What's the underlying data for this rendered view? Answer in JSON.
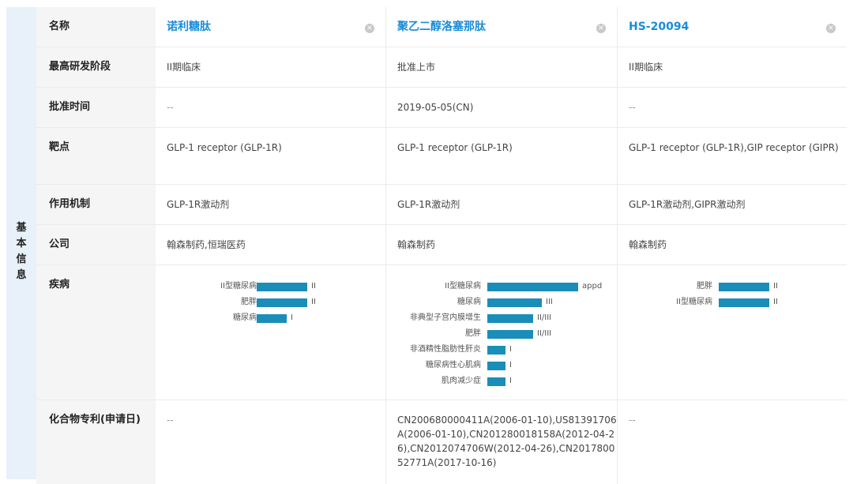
{
  "side_label": [
    "基",
    "本",
    "信",
    "息"
  ],
  "row_labels": {
    "name": "名称",
    "stage": "最高研发阶段",
    "approval": "批准时间",
    "target": "靶点",
    "mechanism": "作用机制",
    "company": "公司",
    "disease": "疾病",
    "patent": "化合物专利(申请日)"
  },
  "close_glyph": "×",
  "drugs": [
    {
      "name": "诺利糖肽",
      "stage": "II期临床",
      "approval": "--",
      "target": "GLP-1 receptor (GLP-1R)",
      "mechanism": "GLP-1R激动剂",
      "company": "翰森制药,恒瑞医药",
      "patent": "--",
      "diseases": [
        {
          "name": "II型糖尿病",
          "phase": "II",
          "level": 2
        },
        {
          "name": "肥胖",
          "phase": "II",
          "level": 2
        },
        {
          "name": "糖尿病",
          "phase": "I",
          "level": 1.2
        }
      ]
    },
    {
      "name": "聚乙二醇洛塞那肽",
      "stage": "批准上市",
      "approval": "2019-05-05(CN)",
      "target": "GLP-1 receptor (GLP-1R)",
      "mechanism": "GLP-1R激动剂",
      "company": "翰森制药",
      "patent": "CN200680000411A(2006-01-10),US81391706A(2006-01-10),CN201280018158A(2012-04-26),CN2012074706W(2012-04-26),CN201780052771A(2017-10-16)",
      "diseases": [
        {
          "name": "II型糖尿病",
          "phase": "appd",
          "level": 5
        },
        {
          "name": "糖尿病",
          "phase": "III",
          "level": 3
        },
        {
          "name": "非典型子宫内膜增生",
          "phase": "II/III",
          "level": 2.5
        },
        {
          "name": "肥胖",
          "phase": "II/III",
          "level": 2.5
        },
        {
          "name": "非酒精性脂肪性肝炎",
          "phase": "I",
          "level": 1
        },
        {
          "name": "糖尿病性心肌病",
          "phase": "I",
          "level": 1
        },
        {
          "name": "肌肉减少症",
          "phase": "I",
          "level": 1
        }
      ]
    },
    {
      "name": "HS-20094",
      "stage": "II期临床",
      "approval": "--",
      "target": "GLP-1 receptor (GLP-1R),GIP receptor (GIPR)",
      "mechanism": "GLP-1R激动剂,GIPR激动剂",
      "company": "翰森制药",
      "patent": "--",
      "diseases": [
        {
          "name": "肥胖",
          "phase": "II",
          "level": 2
        },
        {
          "name": "II型糖尿病",
          "phase": "II",
          "level": 2
        }
      ]
    }
  ],
  "colors": {
    "bar": "#1a8db8",
    "link": "#1a8cd8",
    "side_bg": "#e8f1f9",
    "label_bg": "#f5f5f5"
  }
}
